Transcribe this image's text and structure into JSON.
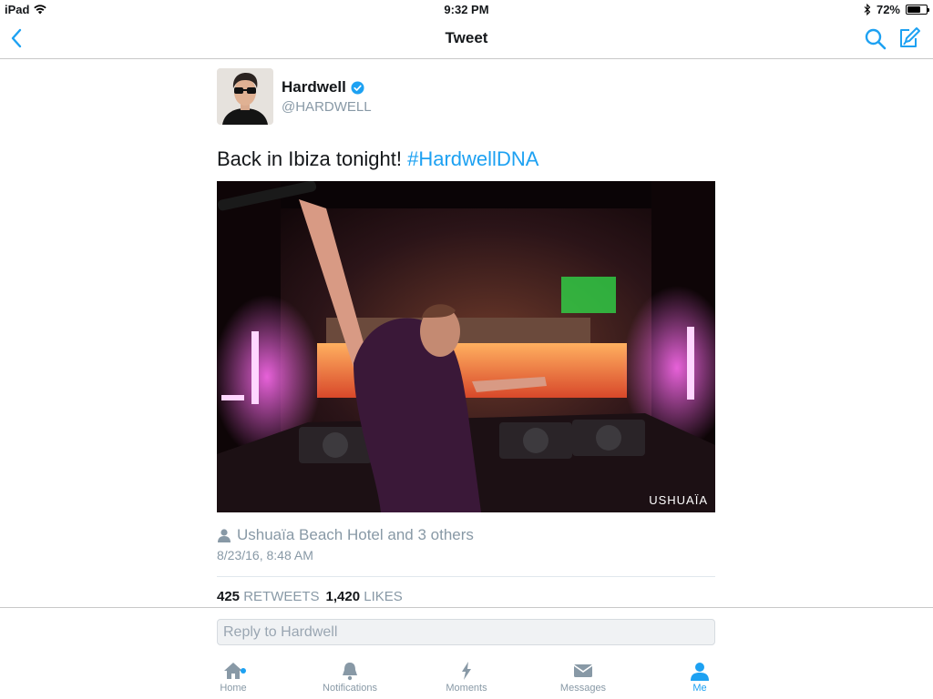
{
  "status_bar": {
    "device": "iPad",
    "time": "9:32 PM",
    "battery": "72%",
    "battery_level": 0.72
  },
  "nav": {
    "title": "Tweet"
  },
  "tweet": {
    "display_name": "Hardwell",
    "handle": "@HARDWELL",
    "text": "Back in Ibiza tonight! ",
    "hashtag": "#HardwellDNA",
    "photo_watermark": "USHUAÏA",
    "location": "Ushuaïa Beach Hotel and 3 others",
    "timestamp": "8/23/16, 8:48 AM",
    "retweets_count": "425",
    "retweets_label": "RETWEETS",
    "likes_count": "1,420",
    "likes_label": "LIKES"
  },
  "reply": {
    "placeholder": "Reply to Hardwell"
  },
  "tabs": {
    "home": "Home",
    "notifications": "Notifications",
    "moments": "Moments",
    "messages": "Messages",
    "me": "Me"
  },
  "colors": {
    "accent": "#1da1f2",
    "muted": "#8899a6"
  }
}
